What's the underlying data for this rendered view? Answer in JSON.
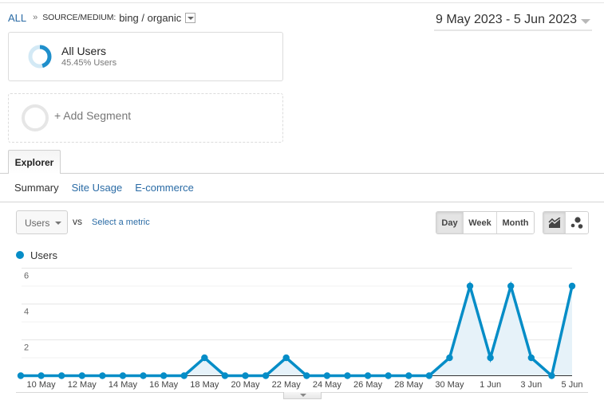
{
  "breadcrumb": {
    "root": "ALL",
    "separator": "»",
    "dimension_label": "SOURCE/MEDIUM:",
    "dimension_value": "bing / organic"
  },
  "date_range": {
    "label": "9 May 2023 - 5 Jun 2023"
  },
  "segments": [
    {
      "name": "All Users",
      "detail": "45.45% Users",
      "share": 0.4545,
      "color": "#1f8fcb",
      "track_color": "#d3e9f5"
    }
  ],
  "add_segment": {
    "label": "+ Add Segment"
  },
  "tabs": [
    {
      "label": "Explorer",
      "active": true
    }
  ],
  "subtabs": [
    {
      "label": "Summary",
      "active": true
    },
    {
      "label": "Site Usage",
      "active": false
    },
    {
      "label": "E-commerce",
      "active": false
    }
  ],
  "controls": {
    "metric_select": "Users",
    "vs_label": "vs",
    "select_metric_link": "Select a metric",
    "granularity": [
      {
        "label": "Day",
        "active": true
      },
      {
        "label": "Week",
        "active": false
      },
      {
        "label": "Month",
        "active": false
      }
    ],
    "chart_types": [
      {
        "icon": "line-chart-icon",
        "active": true
      },
      {
        "icon": "motion-chart-icon",
        "active": false
      }
    ]
  },
  "legend": [
    {
      "label": "Users",
      "color": "#058dc7"
    }
  ],
  "chart_data": {
    "type": "area",
    "title": "",
    "xlabel": "",
    "ylabel": "",
    "ylim": [
      0,
      6
    ],
    "yticks": [
      2,
      4,
      6
    ],
    "ytick_labels": [
      "2",
      "4",
      "6"
    ],
    "grid": true,
    "legend_position": "top-left",
    "x": [
      "9 May",
      "10 May",
      "11 May",
      "12 May",
      "13 May",
      "14 May",
      "15 May",
      "16 May",
      "17 May",
      "18 May",
      "19 May",
      "20 May",
      "21 May",
      "22 May",
      "23 May",
      "24 May",
      "25 May",
      "26 May",
      "27 May",
      "28 May",
      "29 May",
      "30 May",
      "31 May",
      "1 Jun",
      "2 Jun",
      "3 Jun",
      "4 Jun",
      "5 Jun"
    ],
    "xtick_labels": [
      "10 May",
      "12 May",
      "14 May",
      "16 May",
      "18 May",
      "20 May",
      "22 May",
      "24 May",
      "26 May",
      "28 May",
      "30 May",
      "1 Jun",
      "3 Jun",
      "5 Jun"
    ],
    "series": [
      {
        "name": "Users",
        "color": "#058dc7",
        "fill": "#e6f2f9",
        "values": [
          0,
          0,
          0,
          0,
          0,
          0,
          0,
          0,
          0,
          1,
          0,
          0,
          0,
          1,
          0,
          0,
          0,
          0,
          0,
          0,
          0,
          1,
          5,
          1,
          5,
          1,
          0,
          5
        ]
      }
    ]
  }
}
